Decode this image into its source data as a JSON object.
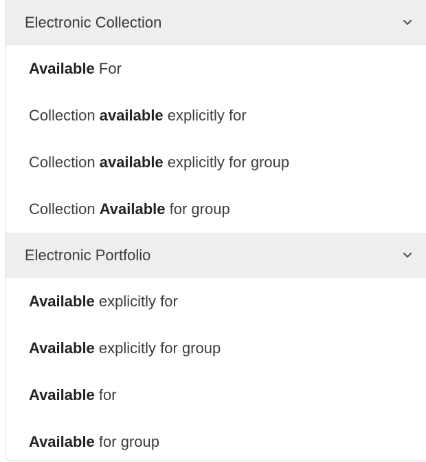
{
  "groups": [
    {
      "header": "Electronic Collection",
      "options": [
        {
          "before": "",
          "bold": "Available",
          "after": " For"
        },
        {
          "before": "Collection ",
          "bold": "available",
          "after": " explicitly for"
        },
        {
          "before": "Collection ",
          "bold": "available",
          "after": " explicitly for group"
        },
        {
          "before": "Collection ",
          "bold": "Available",
          "after": " for group"
        }
      ]
    },
    {
      "header": "Electronic Portfolio",
      "options": [
        {
          "before": "",
          "bold": "Available",
          "after": " explicitly for"
        },
        {
          "before": "",
          "bold": "Available",
          "after": " explicitly for group"
        },
        {
          "before": "",
          "bold": "Available",
          "after": " for"
        },
        {
          "before": "",
          "bold": "Available",
          "after": " for group"
        }
      ]
    }
  ],
  "icons": {
    "group_toggle": "chevron-down-icon"
  }
}
